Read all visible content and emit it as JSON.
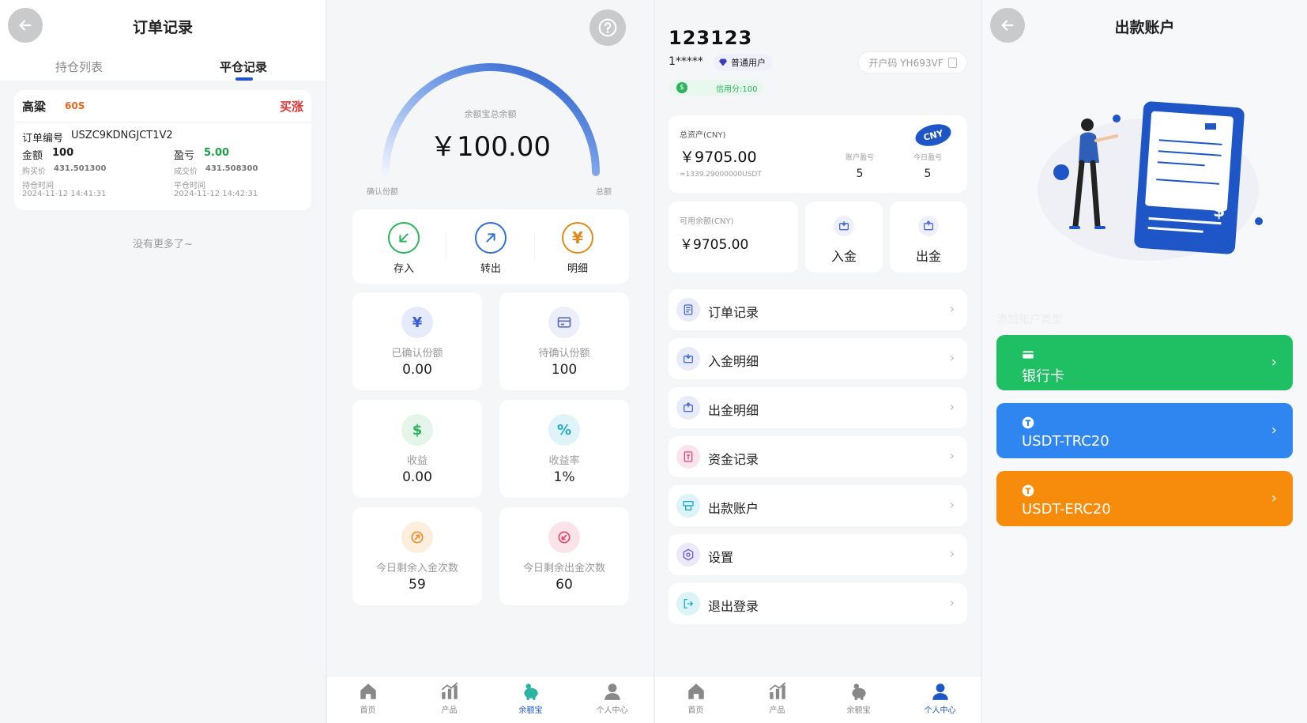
{
  "panel1": {
    "title": "订单记录",
    "tabs": [
      {
        "label": "持仓列表",
        "active": false
      },
      {
        "label": "平仓记录",
        "active": true
      }
    ],
    "order": {
      "name": "高粱",
      "period": "60S",
      "side": "买涨",
      "order_no_label": "订单编号",
      "order_no": "USZC9KDNGJCT1V2",
      "amount_label": "金额",
      "amount": "100",
      "pnl_label": "盈亏",
      "pnl": "5.00",
      "buy_price_label": "购买价",
      "buy_price": "431.501300",
      "deal_price_label": "成交价",
      "deal_price": "431.508300",
      "open_time_label": "持仓时间",
      "open_time": "2024-11-12 14:41:31",
      "close_time_label": "平仓时间",
      "close_time": "2024-11-12 14:42:31"
    },
    "no_more": "没有更多了~"
  },
  "panel2": {
    "gauge": {
      "label": "余额宝总余额",
      "value": "￥100.00",
      "left_label": "确认份额",
      "right_label": "总额",
      "fill_fraction": 1.0
    },
    "actions": [
      {
        "label": "存入",
        "icon": "arrow-down-left-icon",
        "color": "#2bb45a"
      },
      {
        "label": "转出",
        "icon": "arrow-up-right-icon",
        "color": "#2f6fd9"
      },
      {
        "label": "明细",
        "icon": "yen-icon",
        "color": "#e08a1b"
      }
    ],
    "stats": [
      {
        "label": "已确认份额",
        "value": "0.00",
        "icon": "yen-coin-icon",
        "color": "#3a5bd8",
        "bg": "#e6ebfb"
      },
      {
        "label": "待确认份额",
        "value": "100",
        "icon": "card-icon",
        "color": "#5c6ab8",
        "bg": "#eceefa"
      },
      {
        "label": "收益",
        "value": "0.00",
        "icon": "dollar-refresh-icon",
        "color": "#2bb45a",
        "bg": "#e4f6ea"
      },
      {
        "label": "收益率",
        "value": "1%",
        "icon": "percent-icon",
        "color": "#23a8c9",
        "bg": "#def4f9"
      },
      {
        "label": "今日剩余入金次数",
        "value": "59",
        "icon": "deposit-count-icon",
        "color": "#ee8d2b",
        "bg": "#fdeedd"
      },
      {
        "label": "今日剩余出金次数",
        "value": "60",
        "icon": "withdraw-count-icon",
        "color": "#e0456c",
        "bg": "#fbe3ea"
      }
    ],
    "nav": [
      {
        "label": "首页",
        "icon": "home-icon",
        "active": false
      },
      {
        "label": "产品",
        "icon": "chart-icon",
        "active": false
      },
      {
        "label": "余额宝",
        "icon": "piggy-bank-icon",
        "active": true
      },
      {
        "label": "个人中心",
        "icon": "person-icon",
        "active": false
      }
    ]
  },
  "panel3": {
    "uid": "123123",
    "masked_name": "1*****",
    "level": "普通用户",
    "credit": "信用分:100",
    "open_code": "开户码 YH693VF",
    "total_assets_label": "总资产(CNY)",
    "total_assets": "￥9705.00",
    "total_assets_usdt": "≈1339.29000000USDT",
    "currency_badge": "CNY",
    "account_pnl_label": "账户盈亏",
    "account_pnl": "5",
    "today_pnl_label": "今日盈亏",
    "today_pnl": "5",
    "available_label": "可用余额(CNY)",
    "available": "￥9705.00",
    "deposit_label": "入金",
    "withdraw_label": "出金",
    "menu": [
      {
        "label": "订单记录",
        "icon": "document-icon",
        "color": "#4a68d8",
        "bg": "#e8ecfa"
      },
      {
        "label": "入金明细",
        "icon": "deposit-icon",
        "color": "#4a68d8",
        "bg": "#e8ecfa"
      },
      {
        "label": "出金明细",
        "icon": "withdraw-icon",
        "color": "#4a68d8",
        "bg": "#e8ecfa"
      },
      {
        "label": "资金记录",
        "icon": "fund-record-icon",
        "color": "#e0457a",
        "bg": "#fbe4ec"
      },
      {
        "label": "出款账户",
        "icon": "atm-icon",
        "color": "#1faac9",
        "bg": "#dcf3f8"
      },
      {
        "label": "设置",
        "icon": "settings-icon",
        "color": "#6a5bd8",
        "bg": "#ece9fa"
      },
      {
        "label": "退出登录",
        "icon": "logout-icon",
        "color": "#1faac9",
        "bg": "#dcf3f8"
      }
    ],
    "nav": [
      {
        "label": "首页",
        "icon": "home-icon",
        "active": false
      },
      {
        "label": "产品",
        "icon": "chart-icon",
        "active": false
      },
      {
        "label": "余额宝",
        "icon": "piggy-bank-icon",
        "active": false
      },
      {
        "label": "个人中心",
        "icon": "person-icon",
        "active": true
      }
    ]
  },
  "panel4": {
    "title": "出款账户",
    "hint": "添加账户类型",
    "accounts": [
      {
        "label": "银行卡",
        "icon": "bank-card-icon",
        "color": "#1fbf63"
      },
      {
        "label": "USDT-TRC20",
        "icon": "tether-icon",
        "color": "#2f86f0"
      },
      {
        "label": "USDT-ERC20",
        "icon": "tether-icon",
        "color": "#f78b0c"
      }
    ]
  },
  "colors": {
    "primary": "#1e56c8",
    "profit": "#1a9f4a",
    "up": "#e03535"
  }
}
